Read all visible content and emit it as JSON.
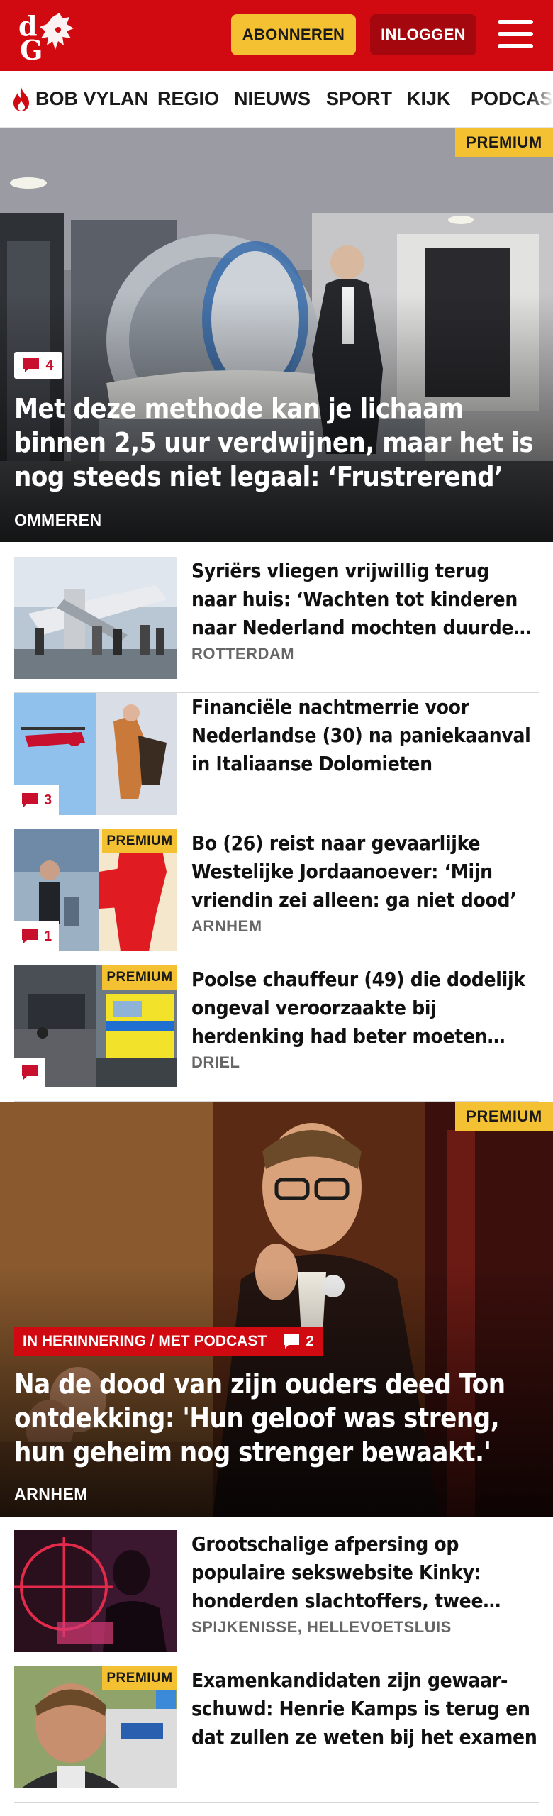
{
  "header": {
    "brand": "dG",
    "subscribe_label": "ABONNEREN",
    "login_label": "INLOGGEN",
    "brand_color": "#d10a11",
    "accent_color": "#f3c132"
  },
  "nav": {
    "items": [
      "BOB VYLAN",
      "REGIO",
      "NIEUWS",
      "SPORT",
      "KIJK",
      "PODCAS"
    ],
    "first_item_icon": "flame-icon"
  },
  "top_story": {
    "premium_label": "PREMIUM",
    "comment_count": "4",
    "title": "Met deze methode kan je lichaam binnen 2,5 uur verdwijnen, maar het is nog steeds niet legaal: ‘Frustrerend’",
    "location": "OMMEREN"
  },
  "articles_1": [
    {
      "title": "Syriërs vliegen vrijwillig terug naar huis: ‘Wachten tot kinderen naar Nederland mochten duurde te lang’",
      "location": "ROTTERDAM",
      "premium": "",
      "comments": ""
    },
    {
      "title": "Financiële nachtmerrie voor Nederlandse (30) na paniekaan­val in Italiaanse Dolomieten",
      "location": "",
      "premium": "",
      "comments": "3"
    },
    {
      "title": "Bo (26) reist naar gevaarlijke Westelijke Jordaanoever: ‘Mijn vriendin zei alleen: ga niet dood’",
      "location": "ARNHEM",
      "premium": "PREMIUM",
      "comments": "1"
    },
    {
      "title": "Poolse chauffeur (49) die dodelijk ongeval veroorzaakte bij herdenking had beter moeten opletten",
      "location": "DRIEL",
      "premium": "PREMIUM",
      "comments": ""
    }
  ],
  "second_story": {
    "premium_label": "PREMIUM",
    "tag": "IN HERINNERING / MET PODCAST",
    "comment_count": "2",
    "title": "Na de dood van zijn ouders deed Ton ontdekking: 'Hun geloof was streng, hun geheim nog strenger bewaakt.'",
    "location": "ARNHEM"
  },
  "articles_2": [
    {
      "title": "Grootschalige afpersing op populaire sekswebsite Kinky: honderden slachtoffers, twee verdachten opgepakt",
      "location": "SPIJKENISSE, HELLEVOETSLUIS",
      "premium": ""
    },
    {
      "title": "Examenkandidaten zijn gewaar­schuwd: Henrie Kamps is terug en dat zullen ze weten bij het examen",
      "location": "",
      "premium": "PREMIUM"
    }
  ]
}
